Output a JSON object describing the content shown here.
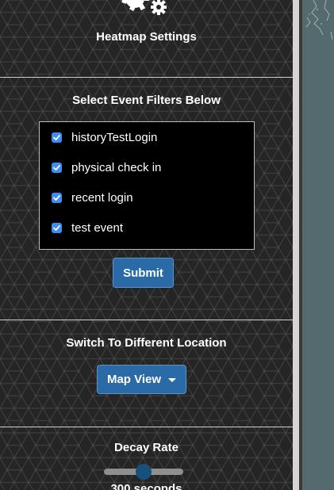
{
  "settings": {
    "heading": "Heatmap Settings"
  },
  "filters": {
    "heading": "Select Event Filters Below",
    "items": [
      {
        "label": "historyTestLogin",
        "checked": true
      },
      {
        "label": "physical check in",
        "checked": true
      },
      {
        "label": "recent login",
        "checked": true
      },
      {
        "label": "test event",
        "checked": true
      }
    ],
    "submit_label": "Submit"
  },
  "location": {
    "heading": "Switch To Different Location",
    "dropdown_label": "Map View"
  },
  "decay": {
    "heading": "Decay Rate",
    "slider_value_fraction": 0.5,
    "value_text": "300 seconds"
  },
  "colors": {
    "panel_bg": "#252525",
    "button_bg": "#2a6aa6",
    "checkbox": "#3d8ef0",
    "map": "#556a6e"
  },
  "icons": {
    "top": "gears-icon",
    "check": "check-icon",
    "caret": "caret-down-icon"
  }
}
